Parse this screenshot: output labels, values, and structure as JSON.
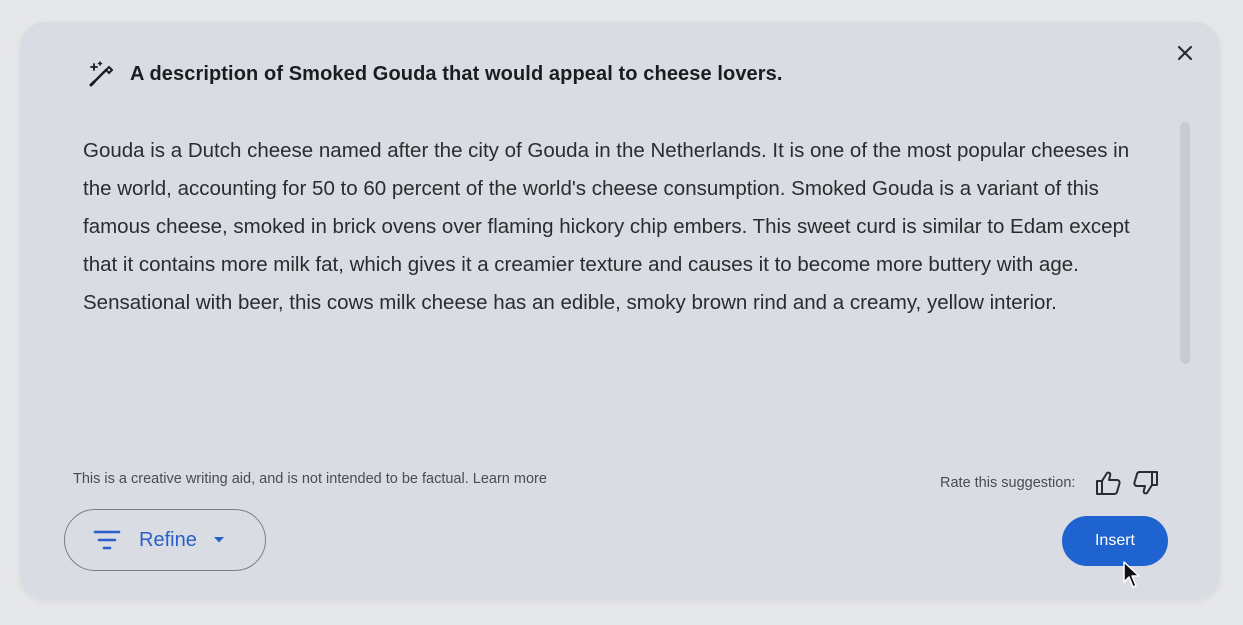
{
  "dialog": {
    "prompt": "A description of Smoked Gouda that would appeal to cheese lovers.",
    "body": "Gouda is a Dutch cheese named after the city of Gouda in the Netherlands. It is one of the most popular cheeses in the world, accounting for 50 to 60 percent of the world's cheese consumption. Smoked Gouda is a variant of this famous cheese, smoked in brick ovens over flaming hickory chip embers. This sweet curd is similar to Edam except that it contains more milk fat, which gives it a creamier texture and causes it to become more buttery with age. Sensational with beer, this cows milk cheese has an edible, smoky brown rind and a creamy, yellow interior.",
    "disclaimer": "This is a creative writing aid, and is not intended to be factual.",
    "learn_more": "Learn more",
    "rate_label": "Rate this suggestion:",
    "refine_label": "Refine",
    "insert_label": "Insert"
  },
  "icons": {
    "prompt_icon": "magic-pen-icon",
    "close": "close-icon",
    "thumbs_up": "thumbs-up-icon",
    "thumbs_down": "thumbs-down-icon",
    "refine": "filter-lines-icon",
    "dropdown": "caret-down-icon",
    "pointer": "mouse-pointer-icon"
  },
  "colors": {
    "accent": "#1f63d1",
    "refine_text": "#2a5fc7",
    "panel_bg": "#d9dce2"
  }
}
